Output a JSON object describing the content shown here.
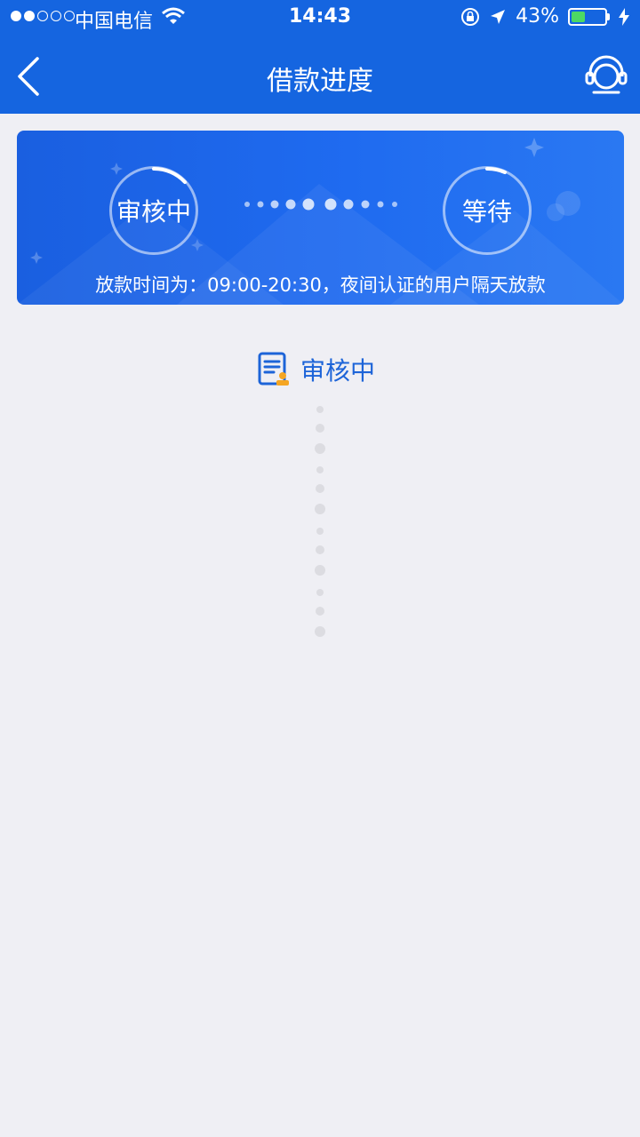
{
  "status_bar": {
    "carrier": "中国电信",
    "time": "14:43",
    "battery": "43%",
    "battery_level": 0.43,
    "colors": {
      "battery_fill": "#4cd964"
    }
  },
  "nav": {
    "title": "借款进度",
    "back_icon": "chevron-left-icon",
    "service_icon": "headset-icon"
  },
  "progress": {
    "steps": [
      {
        "label": "审核中"
      },
      {
        "label": "等待"
      }
    ],
    "note": "放款时间为：09:00-20:30，夜间认证的用户隔天放款"
  },
  "current_state": {
    "icon": "document-review-icon",
    "label": "审核中"
  },
  "colors": {
    "primary": "#1565e0",
    "accent_text": "#1d64d8",
    "icon_orange": "#f5a623",
    "background": "#efeff4"
  }
}
